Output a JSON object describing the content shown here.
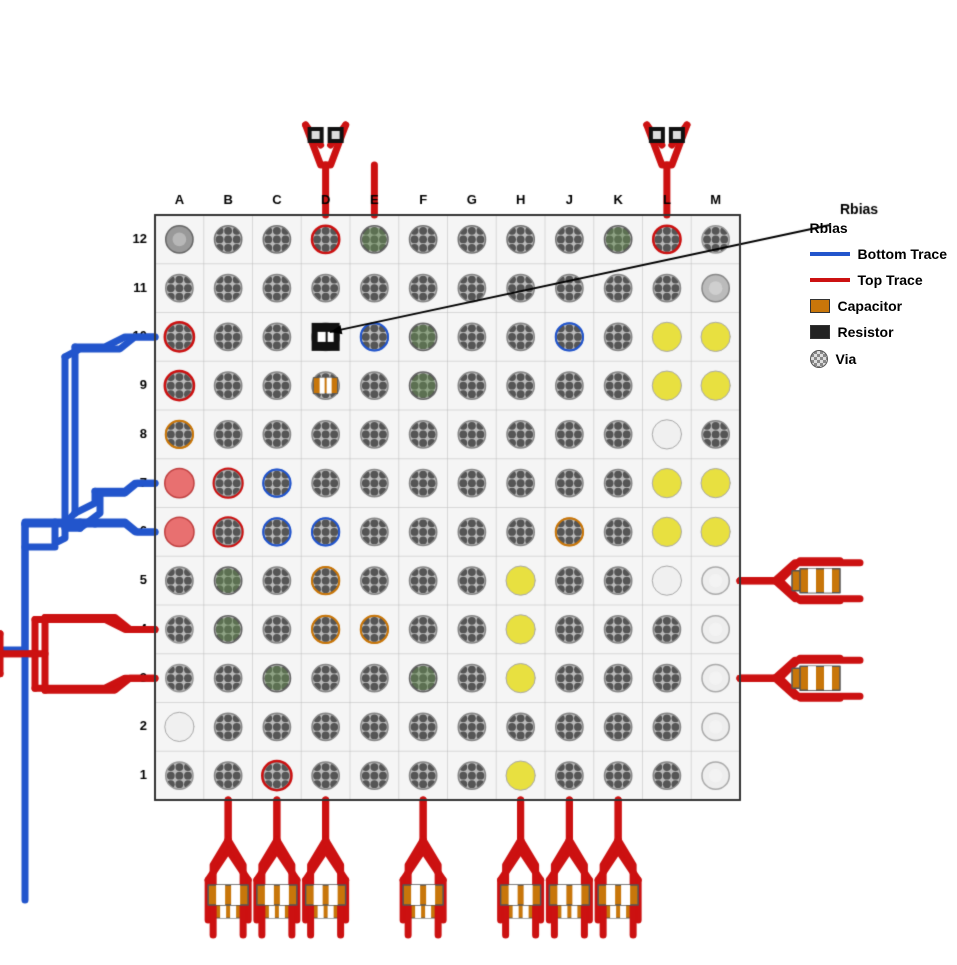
{
  "legend": {
    "rbias": "Rbias",
    "bottom_trace": "Bottom Trace",
    "top_trace": "Top Trace",
    "capacitor": "Capacitor",
    "resistor": "Resistor",
    "via": "Via"
  },
  "grid": {
    "columns": [
      "A",
      "B",
      "C",
      "D",
      "E",
      "F",
      "G",
      "H",
      "J",
      "K",
      "L",
      "M"
    ],
    "rows": [
      12,
      11,
      10,
      9,
      8,
      7,
      6,
      5,
      4,
      3,
      2,
      1
    ]
  },
  "colors": {
    "top_trace": "#cc1111",
    "bottom_trace": "#2255cc",
    "capacitor_fill": "#c8760a",
    "resistor_fill": "#222222",
    "via_pattern": "#888888",
    "grid_bg": "#f8f8f8",
    "grid_border": "#333333"
  }
}
